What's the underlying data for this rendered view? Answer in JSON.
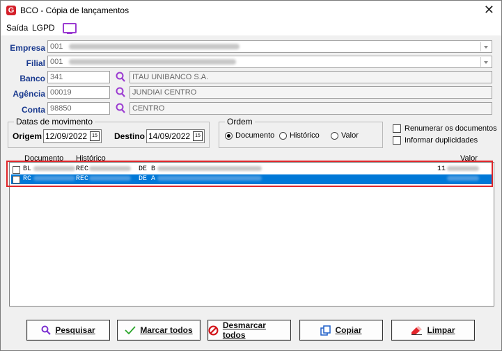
{
  "window": {
    "title": "BCO - Cópia de lançamentos",
    "app_icon": "G"
  },
  "menu": {
    "items": [
      "Saída",
      "LGPD"
    ]
  },
  "form": {
    "empresa": {
      "label": "Empresa",
      "code": "001"
    },
    "filial": {
      "label": "Filial",
      "code": "001"
    },
    "banco": {
      "label": "Banco",
      "code": "341",
      "name": "ITAU UNIBANCO S.A."
    },
    "agencia": {
      "label": "Agência",
      "code": "00019",
      "name": "JUNDIAI CENTRO"
    },
    "conta": {
      "label": "Conta",
      "code": "98850",
      "name": "CENTRO"
    }
  },
  "datas": {
    "title": "Datas de movimento",
    "origem_label": "Origem",
    "origem_value": "12/09/2022",
    "destino_label": "Destino",
    "destino_value": "14/09/2022",
    "cal_label": "15"
  },
  "ordem": {
    "title": "Ordem",
    "options": [
      "Documento",
      "Histórico",
      "Valor"
    ],
    "selected": "Documento"
  },
  "options": {
    "renumerar": "Renumerar os documentos",
    "duplicidades": "Informar duplicidades"
  },
  "grid": {
    "columns": [
      "Documento",
      "Histórico",
      "Valor"
    ],
    "rows": [
      {
        "doc": "BL",
        "hist": "REC",
        "mid": "DE B",
        "valor": "11"
      },
      {
        "doc": "RC",
        "hist": "REC",
        "mid": "DE A",
        "valor": ""
      }
    ]
  },
  "buttons": {
    "pesquisar": "Pesquisar",
    "marcar": "Marcar todos",
    "desmarcar": "Desmarcar todos",
    "copiar": "Copiar",
    "limpar": "Limpar"
  },
  "colors": {
    "label_blue": "#1a3a8f",
    "selection": "#0078d7",
    "highlight": "#e0262a",
    "accent_purple": "#9b3bd1"
  }
}
